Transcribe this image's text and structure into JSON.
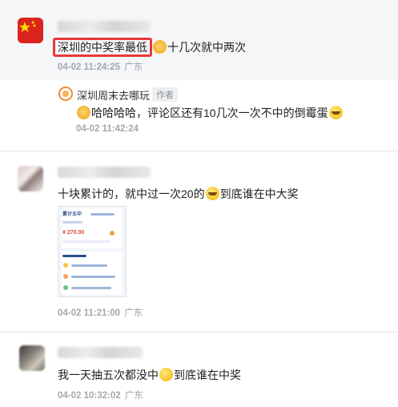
{
  "comments": [
    {
      "text_highlighted": "深圳的中奖率最低",
      "text_rest": "十几次就中两次",
      "time": "04-02 11:24:25",
      "location": "广东",
      "reply": {
        "author": "深圳周末去哪玩",
        "author_tag": "作者",
        "text": "哈哈哈哈，评论区还有10几次一次不中的倒霉蛋",
        "time": "04-02 11:42:24"
      }
    },
    {
      "text_before": "十块累计的，就中过一次20的",
      "text_after": "到底谁在中大奖",
      "time": "04-02 11:21:00",
      "location": "广东",
      "thumbnail": {
        "title": "累计五中",
        "amount": "¥ 270.00"
      }
    },
    {
      "text_before": "我一天抽五次都没中",
      "text_after": "到底谁在中奖",
      "time": "04-02 10:32:02",
      "location": "广东"
    }
  ],
  "colors": {
    "highlight_border": "#e8383d",
    "meta_text": "#9aa0a6",
    "thread_background": "#f5f6f7"
  },
  "icons": [
    "china-flag-avatar",
    "cat-emoji-icon",
    "tear-laugh-emoji-icon",
    "smile-emoji-icon"
  ]
}
